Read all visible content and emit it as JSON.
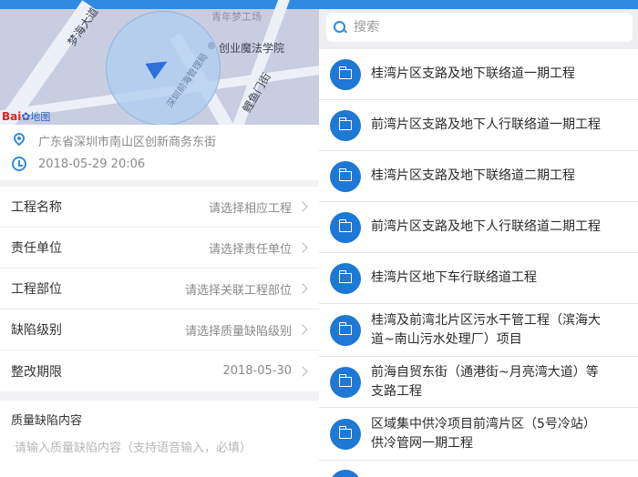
{
  "left": {
    "map": {
      "labels": {
        "top": "青年梦工场",
        "road1": "梦海大道",
        "poi1": "创业魔法学院",
        "road2": "鲤鱼门街",
        "circle_text": "深圳前海管理局"
      },
      "logo_text": "Bai",
      "logo_suffix": "地图"
    },
    "location": {
      "address": "广东省深圳市南山区创新商务东街",
      "time": "2018-05-29 20:06"
    },
    "form": {
      "rows": [
        {
          "label": "工程名称",
          "value": "请选择相应工程"
        },
        {
          "label": "责任单位",
          "value": "请选择责任单位"
        },
        {
          "label": "工程部位",
          "value": "请选择关联工程部位"
        },
        {
          "label": "缺陷级别",
          "value": "请选择质量缺陷级别"
        },
        {
          "label": "整改期限",
          "value": "2018-05-30"
        }
      ]
    },
    "description": {
      "title": "质量缺陷内容",
      "placeholder": "请输入质量缺陷内容（支持语音输入，必填）"
    }
  },
  "right": {
    "search": {
      "placeholder": "搜索"
    },
    "items": [
      {
        "line1": "桂湾片区支路及地下联络道一期工程",
        "line2": ""
      },
      {
        "line1": "前湾片区支路及地下人行联络道一期工程",
        "line2": ""
      },
      {
        "line1": "桂湾片区支路及地下联络道二期工程",
        "line2": ""
      },
      {
        "line1": "前湾片区支路及地下人行联络道二期工程",
        "line2": ""
      },
      {
        "line1": "桂湾片区地下车行联络道工程",
        "line2": ""
      },
      {
        "line1": "桂湾及前湾北片区污水干管工程（滨海大",
        "line2": "道~南山污水处理厂）项目"
      },
      {
        "line1": "前海自贸东街（通港街~月亮湾大道）等",
        "line2": "支路工程"
      },
      {
        "line1": "区域集中供冷项目前湾片区（5号冷站）",
        "line2": "供冷管网一期工程"
      },
      {
        "line1": "",
        "line2": ""
      }
    ]
  },
  "colors": {
    "accent": "#2f8be2",
    "badge": "#1e78d6"
  }
}
